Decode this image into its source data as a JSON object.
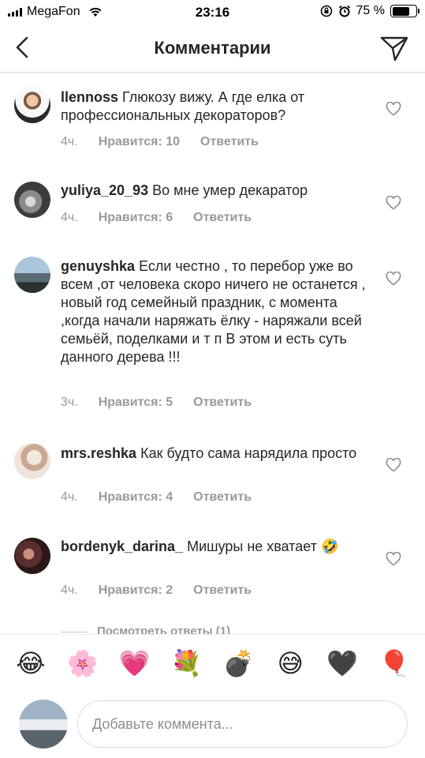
{
  "status_bar": {
    "carrier": "MegaFon",
    "time": "23:16",
    "battery_percent": "75 %",
    "battery_level": 0.75
  },
  "header": {
    "title": "Комментарии"
  },
  "comments": [
    {
      "username": "llennoss",
      "text": "Глюкозу вижу. А где елка от профессиональных декораторов?",
      "time": "4ч.",
      "likes": "Нравится: 10",
      "reply": "Ответить"
    },
    {
      "username": "yuliya_20_93",
      "text": "Во мне умер декаратор",
      "time": "4ч.",
      "likes": "Нравится: 6",
      "reply": "Ответить"
    },
    {
      "username": "genuyshka",
      "text": "Если честно , то перебор уже во всем ,от человека скоро ничего не останется , новый год семейный праздник, с момента ,когда начали наряжать ёлку - наряжали всей семьёй, поделками и т п В этом и есть суть данного дерева !!!",
      "time": "3ч.",
      "likes": "Нравится: 5",
      "reply": "Ответить"
    },
    {
      "username": "mrs.reshka",
      "text": "Как будто сама нарядила просто",
      "time": "4ч.",
      "likes": "Нравится: 4",
      "reply": "Ответить"
    },
    {
      "username": "bordenyk_darina_",
      "text": "Мишуры не хватает 🤣",
      "time": "4ч.",
      "likes": "Нравится: 2",
      "reply": "Ответить"
    }
  ],
  "view_replies": "Посмотреть ответы (1)",
  "emoji_bar": [
    "😂",
    "🌸",
    "💗",
    "💐",
    "💣",
    "😅",
    "🖤",
    "🎈"
  ],
  "input": {
    "placeholder": "Добавьте коммента..."
  },
  "colors": {
    "text": "#262626",
    "meta": "#999999",
    "border": "#dbdbdb"
  },
  "icons": [
    "back-icon",
    "direct-send-icon",
    "heart-icon",
    "wifi-icon",
    "signal-icon",
    "lock-rotation-icon",
    "alarm-icon",
    "battery-icon"
  ]
}
